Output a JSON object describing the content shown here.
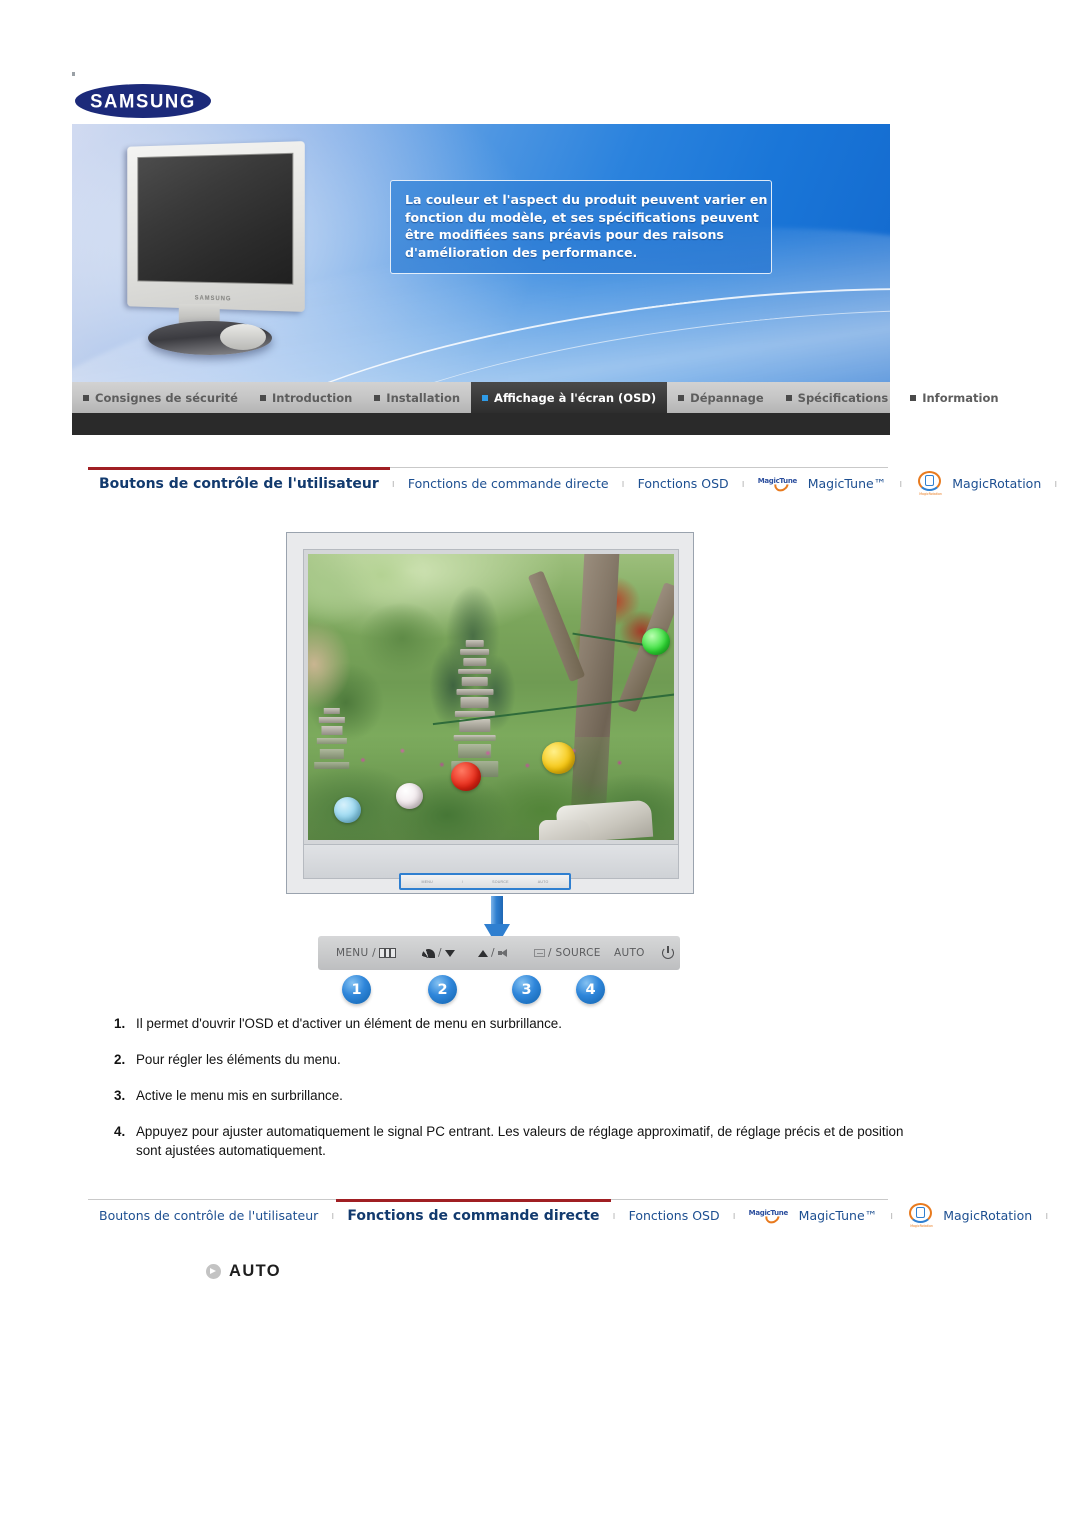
{
  "brand": {
    "logo_text": "SAMSUNG"
  },
  "banner": {
    "notice_lines": [
      "La couleur et l'aspect du produit peuvent varier en",
      "fonction du modèle, et ses spécifications peuvent",
      "être modifiées sans préavis pour des raisons",
      "d'amélioration des performance."
    ],
    "monitor_brand_label": "SAMSUNG"
  },
  "main_tabs": [
    {
      "label": "Consignes de sécurité",
      "active": false
    },
    {
      "label": "Introduction",
      "active": false
    },
    {
      "label": "Installation",
      "active": false
    },
    {
      "label": "Affichage à l'écran (OSD)",
      "active": true
    },
    {
      "label": "Dépannage",
      "active": false
    },
    {
      "label": "Spécifications",
      "active": false
    },
    {
      "label": "Information",
      "active": false
    }
  ],
  "subnav_top": {
    "separator": "ı",
    "items": [
      {
        "label": "Boutons de contrôle de l'utilisateur",
        "current": true,
        "icon": ""
      },
      {
        "label": "Fonctions de commande directe",
        "current": false,
        "icon": ""
      },
      {
        "label": "Fonctions OSD",
        "current": false,
        "icon": ""
      },
      {
        "label": "MagicTune™",
        "current": false,
        "icon": "magictune-logo"
      },
      {
        "label": "MagicRotation",
        "current": false,
        "icon": "magicrotation-logo"
      }
    ]
  },
  "subnav_bottom": {
    "separator": "ı",
    "items": [
      {
        "label": "Boutons de contrôle de l'utilisateur",
        "current": false,
        "icon": ""
      },
      {
        "label": "Fonctions de commande directe",
        "current": true,
        "icon": ""
      },
      {
        "label": "Fonctions OSD",
        "current": false,
        "icon": ""
      },
      {
        "label": "MagicTune™",
        "current": false,
        "icon": "magictune-logo"
      },
      {
        "label": "MagicRotation",
        "current": false,
        "icon": "magicrotation-logo"
      }
    ]
  },
  "magictune_logo_word": "MagicTune",
  "magicrotation_logo_caption": "MagicRotation",
  "diagram": {
    "osd_strip_labels": [
      "MENU",
      "/",
      "SOURCE",
      "AUTO"
    ],
    "photo_description": "jardin avec pagode en pierre et lanternes"
  },
  "control_bar": {
    "buttons": [
      {
        "label": "MENU /",
        "icon": "menu-rect-icon"
      },
      {
        "label": "/",
        "icon": "brightness-icon",
        "icon2": "triangle-down-icon"
      },
      {
        "label": "/",
        "icon": "triangle-up-icon",
        "icon2": "volume-icon"
      },
      {
        "label": "/ SOURCE",
        "icon": "enter-icon"
      },
      {
        "label": "AUTO",
        "icon": ""
      },
      {
        "label": "",
        "icon": "power-icon"
      }
    ],
    "badges": [
      "1",
      "2",
      "3",
      "4"
    ]
  },
  "steps": [
    {
      "num": "1.",
      "text": "Il permet d'ouvrir l'OSD et d'activer un élément de menu en surbrillance."
    },
    {
      "num": "2.",
      "text": "Pour régler les éléments du menu."
    },
    {
      "num": "3.",
      "text": "Active le menu mis en surbrillance."
    },
    {
      "num": "4.",
      "text": "Appuyez pour ajuster automatiquement le signal PC entrant. Les valeurs de réglage approximatif, de réglage précis et de position sont ajustées automatiquement."
    }
  ],
  "auto_section": {
    "title": "AUTO"
  },
  "colors": {
    "accent_blue": "#2f7fd0",
    "brand_navy": "#1c2a7a",
    "subnav_link": "#1d4f91",
    "subnav_underline": "#a01f23",
    "tab_active_bg": "#3a3a3a",
    "tab_active_bullet": "#2f9ce8"
  }
}
